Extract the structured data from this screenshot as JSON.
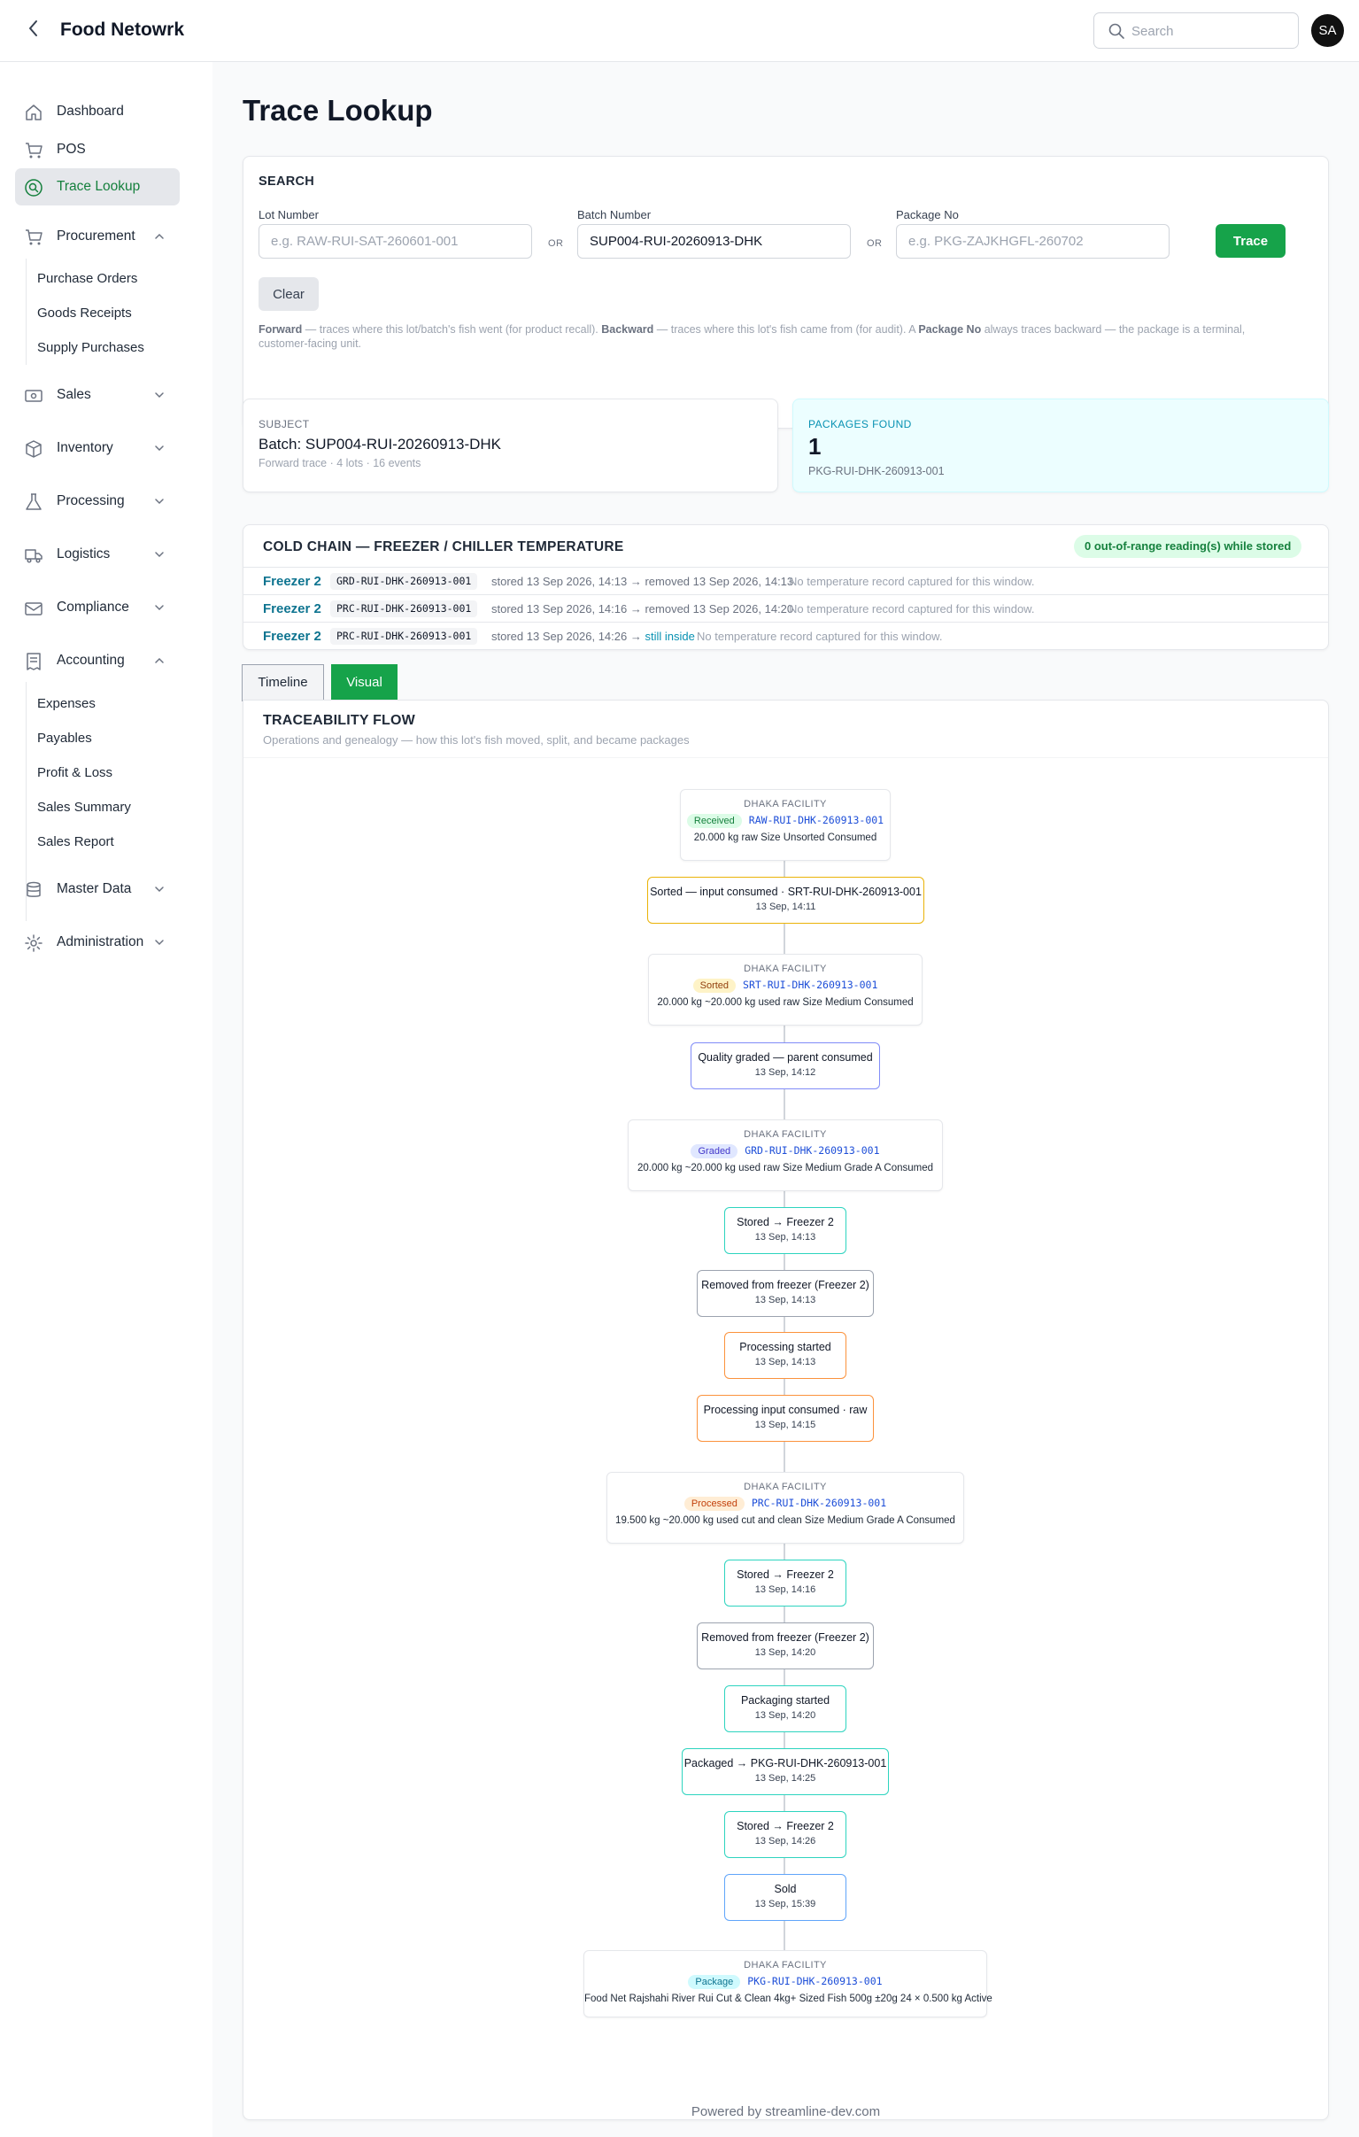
{
  "app": {
    "title": "Food Netowrk",
    "avatar_initials": "SA"
  },
  "header": {
    "search_placeholder": "Search"
  },
  "sidebar": {
    "items": [
      {
        "label": "Dashboard",
        "icon": "home-icon"
      },
      {
        "label": "POS",
        "icon": "cart-icon"
      },
      {
        "label": "Trace Lookup",
        "icon": "search-circle-icon",
        "active": true
      },
      {
        "label": "Procurement",
        "icon": "cart-icon",
        "expanded": true,
        "children": [
          "Purchase Orders",
          "Goods Receipts",
          "Supply Purchases"
        ]
      },
      {
        "label": "Sales",
        "icon": "money-icon"
      },
      {
        "label": "Inventory",
        "icon": "box-icon"
      },
      {
        "label": "Processing",
        "icon": "flask-icon"
      },
      {
        "label": "Logistics",
        "icon": "truck-icon"
      },
      {
        "label": "Compliance",
        "icon": "mail-icon"
      },
      {
        "label": "Accounting",
        "icon": "receipt-icon",
        "expanded": true,
        "children": [
          "Expenses",
          "Payables",
          "Profit & Loss",
          "Sales Summary",
          "Sales Report"
        ]
      },
      {
        "label": "Master Data",
        "icon": "database-icon"
      },
      {
        "label": "Administration",
        "icon": "gear-icon"
      }
    ]
  },
  "page": {
    "title": "Trace Lookup"
  },
  "search_panel": {
    "title": "SEARCH",
    "lot_label": "Lot Number",
    "lot_placeholder": "e.g. RAW-RUI-SAT-260601-001",
    "or": "OR",
    "batch_label": "Batch Number",
    "batch_value": "SUP004-RUI-20260913-DHK",
    "package_label": "Package No",
    "package_placeholder": "e.g. PKG-ZAJKHGFL-260702",
    "trace_button": "Trace",
    "clear_button": "Clear",
    "help": {
      "forward": "Forward",
      "forward_text": " — traces where this lot/batch's fish went (for product recall). ",
      "backward": "Backward",
      "backward_text": " — traces where this lot's fish came from (for audit). A ",
      "package_no": "Package No",
      "package_text": " always traces backward — the package is a terminal, customer-facing unit."
    }
  },
  "subject": {
    "label": "SUBJECT",
    "value": "Batch: SUP004-RUI-20260913-DHK",
    "meta": "Forward trace · 4 lots · 16 events"
  },
  "packages_found": {
    "label": "PACKAGES FOUND",
    "count": "1",
    "code": "PKG-RUI-DHK-260913-001"
  },
  "cold_chain": {
    "title": "COLD CHAIN — FREEZER / CHILLER TEMPERATURE",
    "badge": "0 out-of-range reading(s) while stored",
    "rows": [
      {
        "freezer": "Freezer 2",
        "code": "GRD-RUI-DHK-260913-001",
        "stored": "stored 13 Sep 2026, 14:13 → removed 13 Sep 2026, 14:13",
        "still_inside": "",
        "note": "No temperature record captured for this window."
      },
      {
        "freezer": "Freezer 2",
        "code": "PRC-RUI-DHK-260913-001",
        "stored": "stored 13 Sep 2026, 14:16 → removed 13 Sep 2026, 14:20",
        "still_inside": "",
        "note": "No temperature record captured for this window."
      },
      {
        "freezer": "Freezer 2",
        "code": "PRC-RUI-DHK-260913-001",
        "stored": "stored 13 Sep 2026, 14:26 → ",
        "still_inside": "still inside",
        "note": "No temperature record captured for this window."
      }
    ]
  },
  "tabs": {
    "timeline": "Timeline",
    "visual": "Visual"
  },
  "flow": {
    "title": "TRACEABILITY FLOW",
    "subtitle": "Operations and genealogy — how this lot's fish moved, split, and became packages",
    "lots": [
      {
        "facility": "DHAKA FACILITY",
        "status": "Received",
        "code": "RAW-RUI-DHK-260913-001",
        "details": "20.000 kg   raw   Size Unsorted   Consumed"
      },
      {
        "facility": "DHAKA FACILITY",
        "status": "Sorted",
        "code": "SRT-RUI-DHK-260913-001",
        "details": "20.000 kg   ~20.000 kg used   raw   Size Medium   Consumed"
      },
      {
        "facility": "DHAKA FACILITY",
        "status": "Graded",
        "code": "GRD-RUI-DHK-260913-001",
        "details": "20.000 kg   ~20.000 kg used   raw   Size Medium   Grade A   Consumed"
      },
      {
        "facility": "DHAKA FACILITY",
        "status": "Processed",
        "code": "PRC-RUI-DHK-260913-001",
        "details": "19.500 kg   ~20.000 kg used   cut and clean   Size Medium   Grade A   Consumed"
      },
      {
        "facility": "DHAKA FACILITY",
        "status": "Package",
        "code": "PKG-RUI-DHK-260913-001",
        "details": "Food Net Rajshahi River Rui Cut & Clean 4kg+ Sized Fish 500g ±20g   24 × 0.500 kg   Active"
      }
    ],
    "events": [
      {
        "title": "Sorted — input consumed · SRT-RUI-DHK-260913-001",
        "date": "13 Sep, 14:11"
      },
      {
        "title": "Quality graded — parent consumed",
        "date": "13 Sep, 14:12"
      },
      {
        "title": "Stored → Freezer 2",
        "date": "13 Sep, 14:13"
      },
      {
        "title": "Removed from freezer (Freezer 2)",
        "date": "13 Sep, 14:13"
      },
      {
        "title": "Processing started",
        "date": "13 Sep, 14:13"
      },
      {
        "title": "Processing input consumed · raw",
        "date": "13 Sep, 14:15"
      },
      {
        "title": "Stored → Freezer 2",
        "date": "13 Sep, 14:16"
      },
      {
        "title": "Removed from freezer (Freezer 2)",
        "date": "13 Sep, 14:20"
      },
      {
        "title": "Packaging started",
        "date": "13 Sep, 14:20"
      },
      {
        "title": "Packaged → PKG-RUI-DHK-260913-001",
        "date": "13 Sep, 14:25"
      },
      {
        "title": "Stored → Freezer 2",
        "date": "13 Sep, 14:26"
      },
      {
        "title": "Sold",
        "date": "13 Sep, 15:39"
      }
    ]
  },
  "colors": {
    "brand": "#16a34a",
    "received": "#dcfce7",
    "sorted": "#fef3c7",
    "graded": "#e0e7ff",
    "processed": "#ffedd5",
    "package": "#cffafe",
    "event_amber": "#eab308",
    "event_indigo": "#818cf8",
    "event_teal": "#2dd4bf",
    "event_gray": "#9ca3af",
    "event_orange": "#fb923c",
    "event_blue": "#60a5fa"
  },
  "footer": {
    "text": "Powered by streamline-dev.com"
  }
}
